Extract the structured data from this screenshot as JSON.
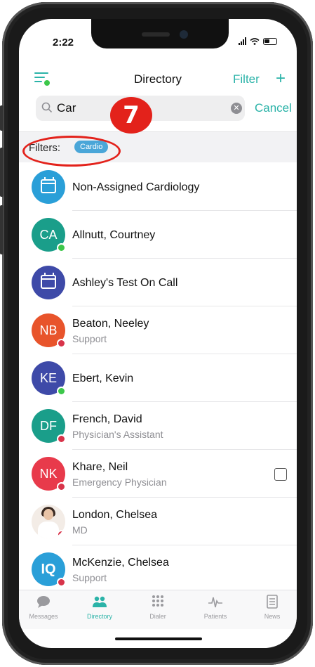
{
  "status_bar": {
    "time": "2:22"
  },
  "nav": {
    "title": "Directory",
    "filter_label": "Filter",
    "add_label": "+"
  },
  "search": {
    "value": "Car",
    "cancel_label": "Cancel"
  },
  "annotation": {
    "step_number": "7"
  },
  "filters": {
    "label": "Filters:",
    "chips": [
      "Cardio"
    ]
  },
  "directory": [
    {
      "name": "Non-Assigned Cardiology",
      "subtitle": "",
      "avatar_type": "calendar",
      "avatar_color": "#2a9fd8",
      "presence": ""
    },
    {
      "name": "Allnutt, Courtney",
      "subtitle": "",
      "initials": "CA",
      "avatar_color": "#1a9e8a",
      "presence": "available"
    },
    {
      "name": "Ashley's Test On Call",
      "subtitle": "",
      "avatar_type": "calendar",
      "avatar_color": "#3e4aa8",
      "presence": ""
    },
    {
      "name": "Beaton, Neeley",
      "subtitle": "Support",
      "initials": "NB",
      "avatar_color": "#e8542b",
      "presence": "busy"
    },
    {
      "name": "Ebert, Kevin",
      "subtitle": "",
      "initials": "KE",
      "avatar_color": "#3e4aa8",
      "presence": "available"
    },
    {
      "name": "French, David",
      "subtitle": "Physician's Assistant",
      "initials": "DF",
      "avatar_color": "#1a9e8a",
      "presence": "busy"
    },
    {
      "name": "Khare, Neil",
      "subtitle": "Emergency Physician",
      "initials": "NK",
      "avatar_color": "#e83a4b",
      "presence": "busy",
      "has_note": true
    },
    {
      "name": "London, Chelsea",
      "subtitle": "MD",
      "avatar_type": "photo",
      "presence": "busy"
    },
    {
      "name": "McKenzie, Chelsea",
      "subtitle": "Support",
      "initials": "IQ",
      "avatar_color": "#2a9fd8",
      "presence": "busy"
    }
  ],
  "tabs": [
    {
      "label": "Messages",
      "icon": "chat-bubble-icon",
      "active": false
    },
    {
      "label": "Directory",
      "icon": "people-icon",
      "active": true
    },
    {
      "label": "Dialer",
      "icon": "dialpad-icon",
      "active": false
    },
    {
      "label": "Patients",
      "icon": "pulse-icon",
      "active": false
    },
    {
      "label": "News",
      "icon": "newspaper-icon",
      "active": false
    }
  ],
  "colors": {
    "accent": "#2bb3a8",
    "annotation": "#e3221b",
    "available": "#3cc74a",
    "busy": "#d8344a",
    "chip": "#4aa6d8"
  }
}
